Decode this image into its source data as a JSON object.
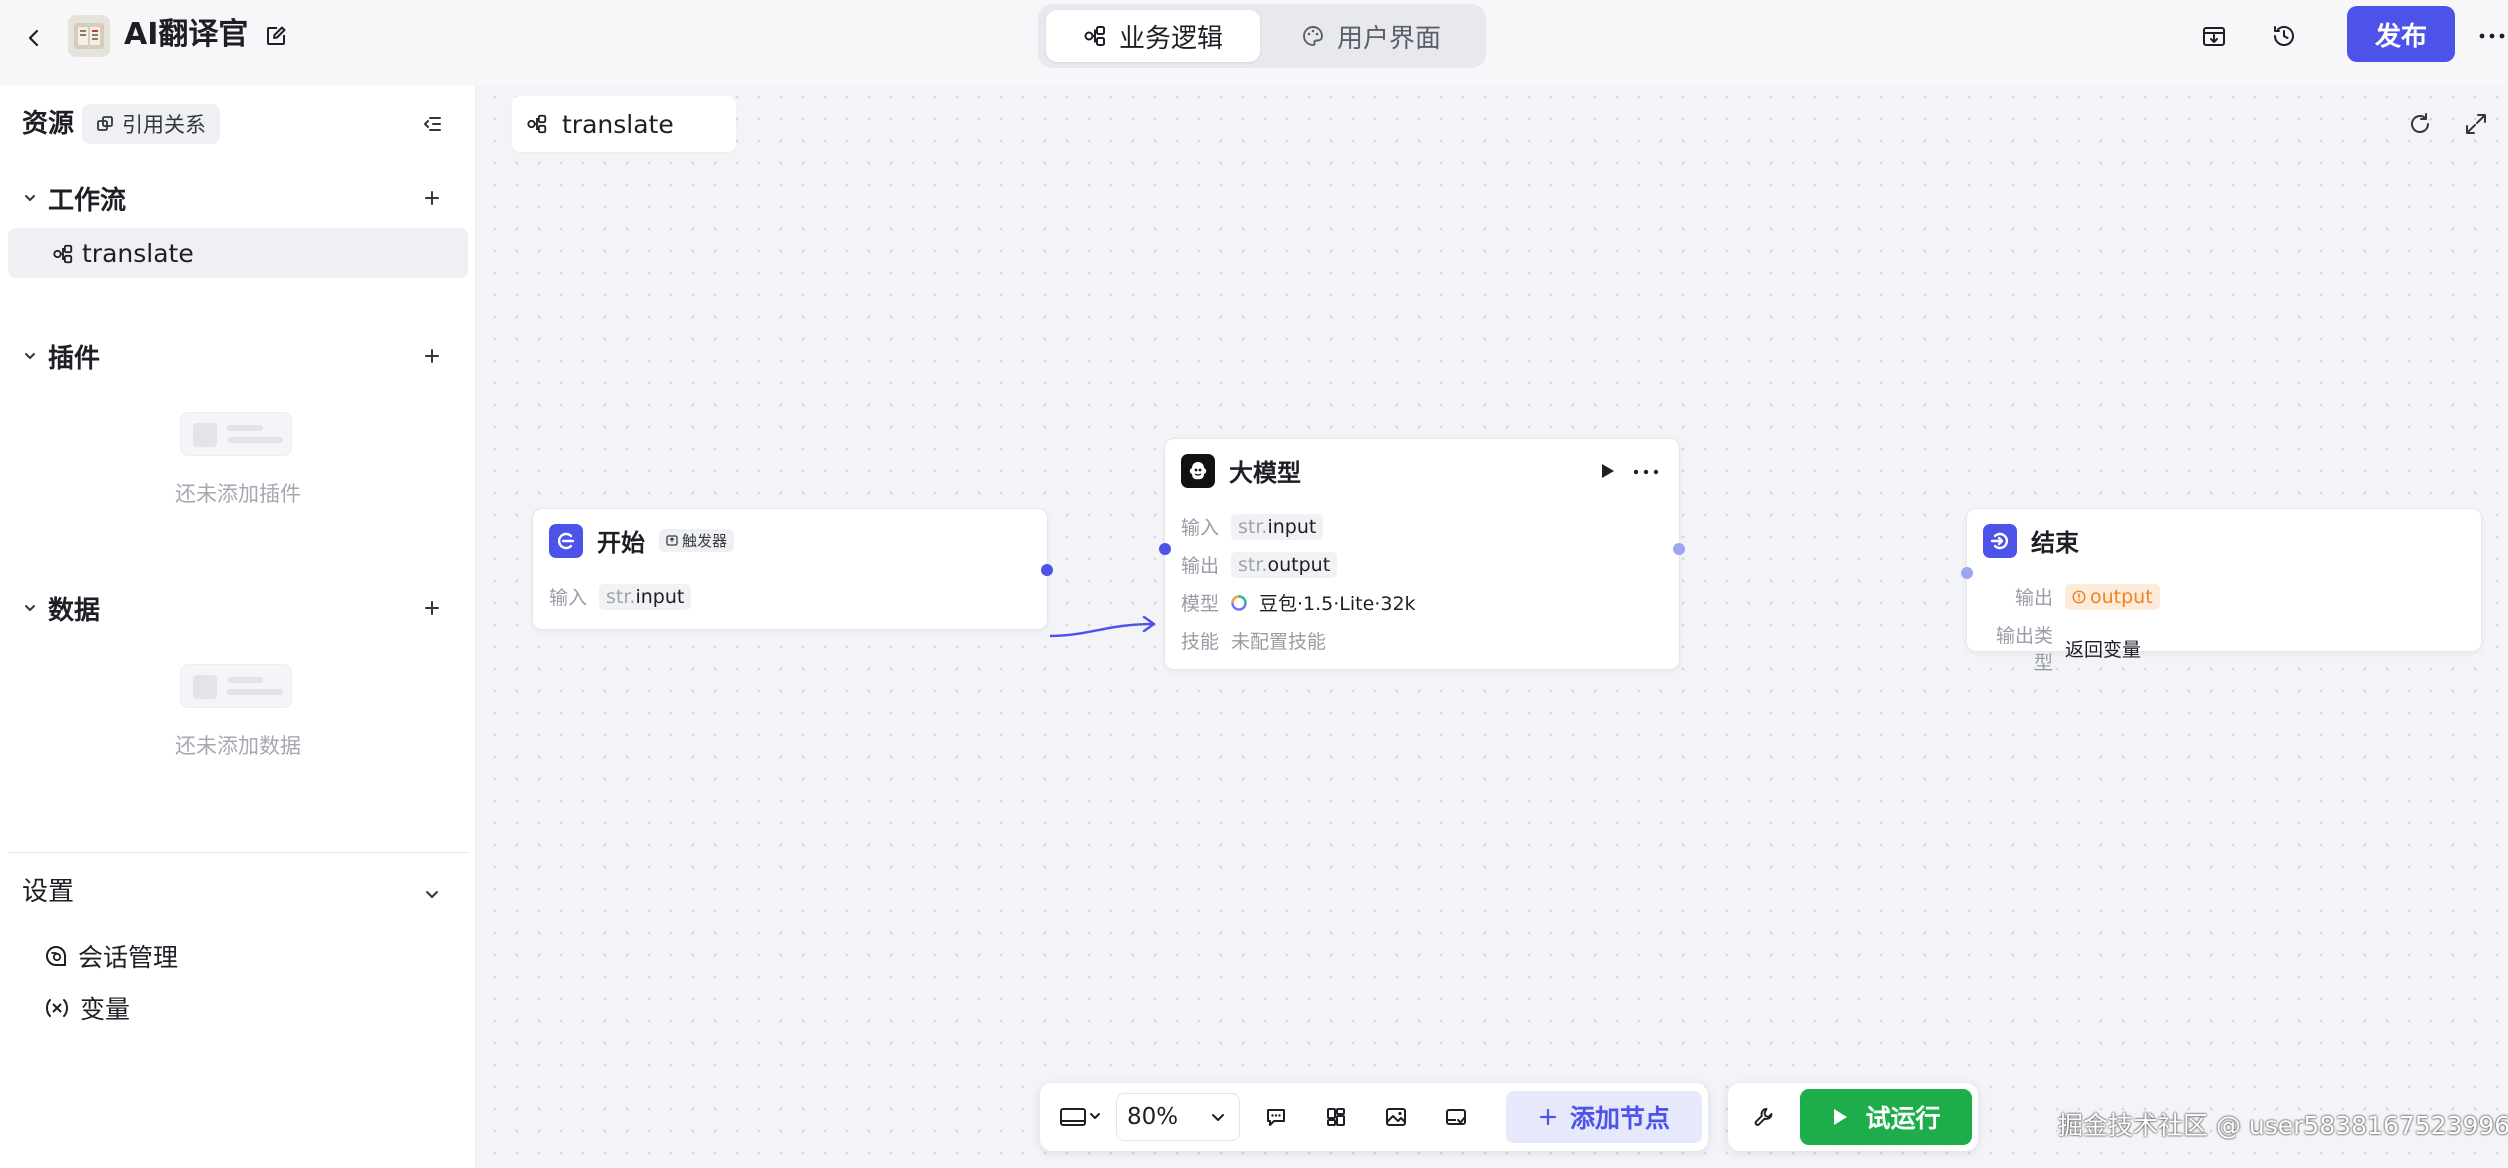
{
  "header": {
    "app_title": "AI翻译官",
    "tabs": [
      {
        "label": "业务逻辑",
        "active": true
      },
      {
        "label": "用户界面",
        "active": false
      }
    ],
    "publish_label": "发布"
  },
  "sidebar": {
    "title": "资源",
    "ref_label": "引用关系",
    "sections": {
      "workflow": {
        "label": "工作流",
        "items": [
          {
            "label": "translate"
          }
        ]
      },
      "plugins": {
        "label": "插件",
        "empty_text": "还未添加插件"
      },
      "data": {
        "label": "数据",
        "empty_text": "还未添加数据"
      }
    },
    "settings": {
      "label": "设置",
      "items": [
        {
          "label": "会话管理",
          "icon": "chat-settings-icon"
        },
        {
          "label": "变量",
          "icon": "variable-icon"
        }
      ]
    }
  },
  "canvas": {
    "tab_label": "translate",
    "nodes": {
      "start": {
        "title": "开始",
        "tag": "触发器",
        "input_key": "输入",
        "input_type": "str.",
        "input_name": "input"
      },
      "llm": {
        "title": "大模型",
        "input_key": "输入",
        "input_type": "str.",
        "input_name": "input",
        "output_key": "输出",
        "output_type": "str.",
        "output_name": "output",
        "model_key": "模型",
        "model_value": "豆包·1.5·Lite·32k",
        "skill_key": "技能",
        "skill_value": "未配置技能"
      },
      "end": {
        "title": "结束",
        "output_key": "输出",
        "output_value": "output",
        "output_type_key": "输出类型",
        "output_type_value": "返回变量"
      }
    }
  },
  "toolbar": {
    "zoom": "80%",
    "add_node_label": "添加节点",
    "run_label": "试运行"
  },
  "watermark": "掘金技术社区 @ user5838167523996",
  "colors": {
    "accent": "#4d53e8",
    "run_green": "#1dad4b",
    "warning_orange": "#f5801f"
  }
}
